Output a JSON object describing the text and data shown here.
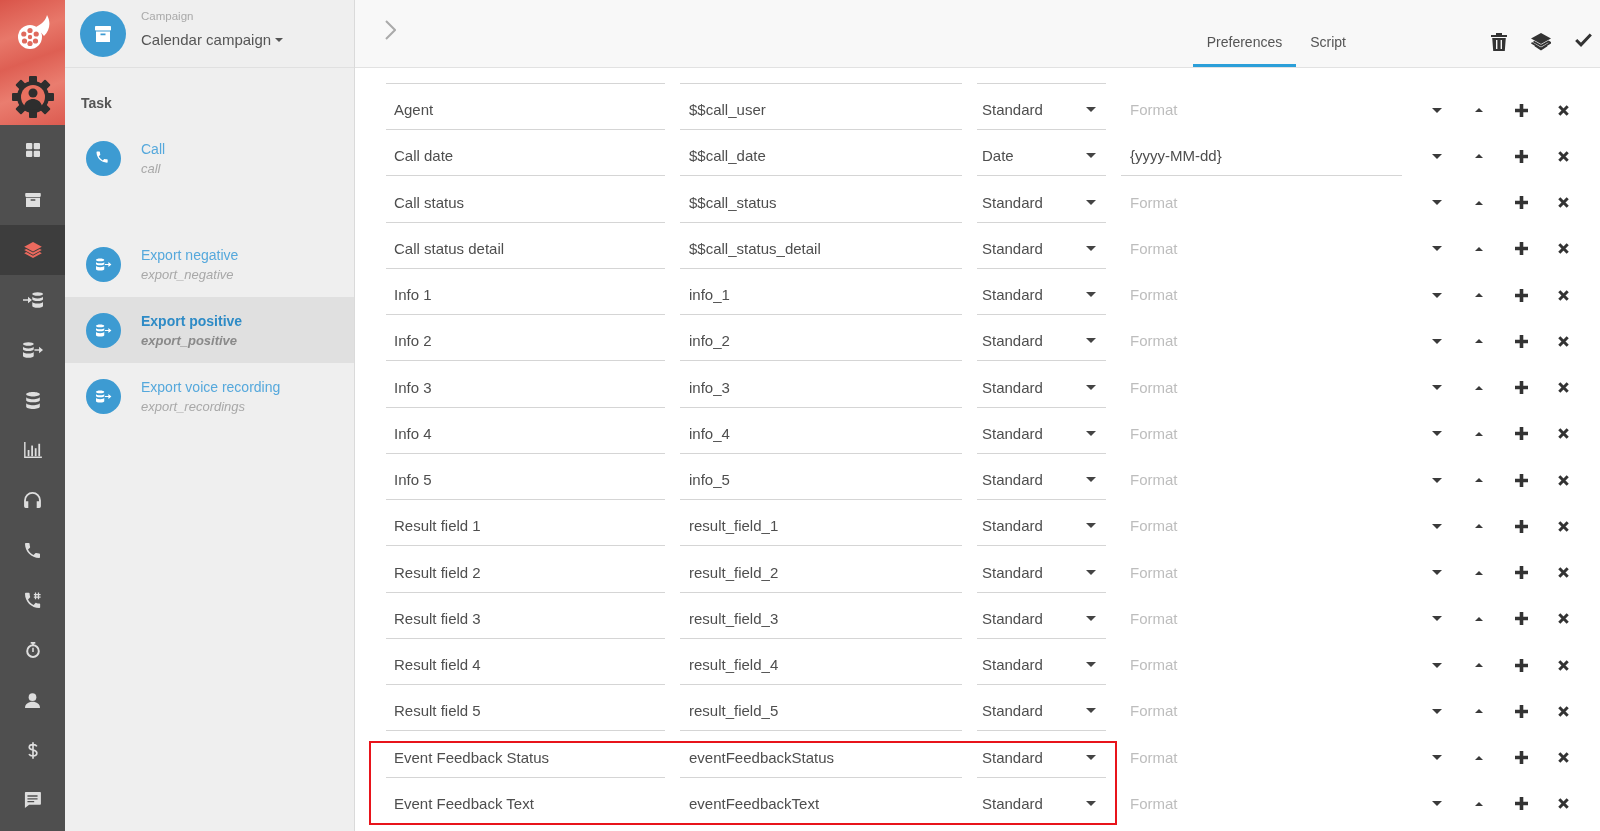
{
  "nav": {
    "items": [
      {
        "kind": "dashboard",
        "selected": false
      },
      {
        "kind": "archive",
        "selected": false
      },
      {
        "kind": "layers",
        "selected": true
      },
      {
        "kind": "database-import",
        "selected": false
      },
      {
        "kind": "database-export",
        "selected": false
      },
      {
        "kind": "database",
        "selected": false
      },
      {
        "kind": "bar-chart",
        "selected": false
      },
      {
        "kind": "headset",
        "selected": false
      },
      {
        "kind": "phone",
        "selected": false
      },
      {
        "kind": "phone-hash",
        "selected": false
      },
      {
        "kind": "stopwatch",
        "selected": false
      },
      {
        "kind": "person",
        "selected": false
      },
      {
        "kind": "dollar",
        "selected": false
      },
      {
        "kind": "chat",
        "selected": false
      }
    ]
  },
  "campaign": {
    "label": "Campaign",
    "name": "Calendar campaign"
  },
  "tasks": {
    "title": "Task",
    "items": [
      {
        "kind": "call",
        "title": "Call",
        "subtitle": "call",
        "selected": false
      },
      {
        "kind": "export",
        "title": "Export negative",
        "subtitle": "export_negative",
        "selected": false
      },
      {
        "kind": "export",
        "title": "Export positive",
        "subtitle": "export_positive",
        "selected": true
      },
      {
        "kind": "export",
        "title": "Export voice recording",
        "subtitle": "export_recordings",
        "selected": false
      }
    ]
  },
  "tabs": [
    {
      "label": "Preferences",
      "selected": true
    },
    {
      "label": "Script",
      "selected": false
    }
  ],
  "fields": {
    "rows": [
      {
        "name": "Agent",
        "value": "$$call_user",
        "type": "Standard",
        "placeholder": "Format",
        "highlighted": false
      },
      {
        "name": "Call date",
        "value": "$$call_date",
        "type": "Date",
        "format": "{yyyy-MM-dd}",
        "highlighted": false
      },
      {
        "name": "Call status",
        "value": "$$call_status",
        "type": "Standard",
        "placeholder": "Format",
        "highlighted": false
      },
      {
        "name": "Call status detail",
        "value": "$$call_status_detail",
        "type": "Standard",
        "placeholder": "Format",
        "highlighted": false
      },
      {
        "name": "Info 1",
        "value": "info_1",
        "type": "Standard",
        "placeholder": "Format",
        "highlighted": false
      },
      {
        "name": "Info 2",
        "value": "info_2",
        "type": "Standard",
        "placeholder": "Format",
        "highlighted": false
      },
      {
        "name": "Info 3",
        "value": "info_3",
        "type": "Standard",
        "placeholder": "Format",
        "highlighted": false
      },
      {
        "name": "Info 4",
        "value": "info_4",
        "type": "Standard",
        "placeholder": "Format",
        "highlighted": false
      },
      {
        "name": "Info 5",
        "value": "info_5",
        "type": "Standard",
        "placeholder": "Format",
        "highlighted": false
      },
      {
        "name": "Result field 1",
        "value": "result_field_1",
        "type": "Standard",
        "placeholder": "Format",
        "highlighted": false
      },
      {
        "name": "Result field 2",
        "value": "result_field_2",
        "type": "Standard",
        "placeholder": "Format",
        "highlighted": false
      },
      {
        "name": "Result field 3",
        "value": "result_field_3",
        "type": "Standard",
        "placeholder": "Format",
        "highlighted": false
      },
      {
        "name": "Result field 4",
        "value": "result_field_4",
        "type": "Standard",
        "placeholder": "Format",
        "highlighted": false
      },
      {
        "name": "Result field 5",
        "value": "result_field_5",
        "type": "Standard",
        "placeholder": "Format",
        "highlighted": false
      },
      {
        "name": "Event Feedback Status",
        "value": "eventFeedbackStatus",
        "type": "Standard",
        "placeholder": "Format",
        "highlighted": true
      },
      {
        "name": "Event Feedback Text",
        "value": "eventFeedbackText",
        "type": "Standard",
        "placeholder": "Format",
        "highlighted": true
      }
    ]
  }
}
